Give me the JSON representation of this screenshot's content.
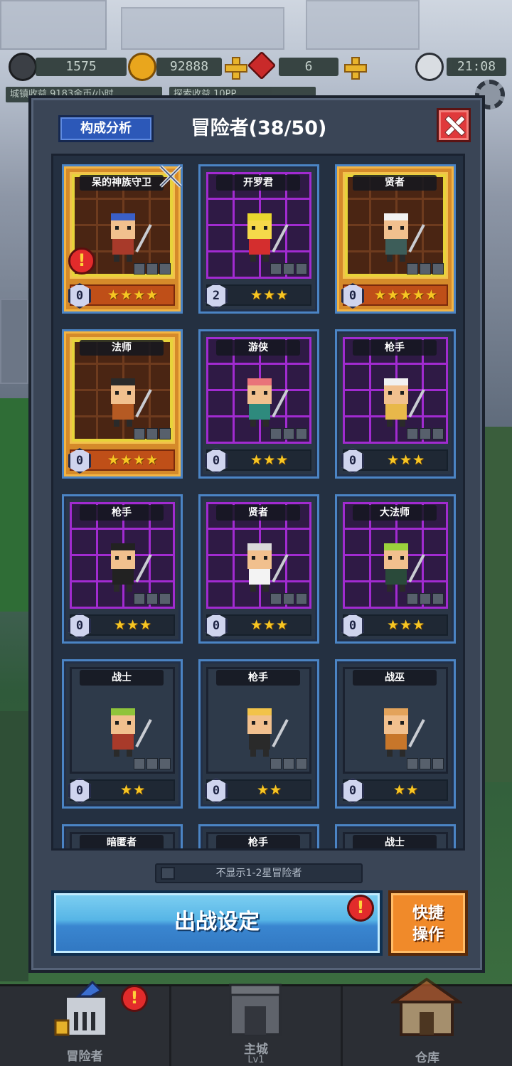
{
  "hud": {
    "power_value": "1575",
    "gold_value": "92888",
    "gem_value": "6",
    "clock": "21:08",
    "sub_left": "城镇收益  9183金币/小时",
    "sub_mid": "探索收益  10PP"
  },
  "modal": {
    "analysis_label": "构成分析",
    "title": "冒险者(38/50)",
    "close_icon": "close-x-icon"
  },
  "cards": [
    {
      "name": "呆的神族守卫",
      "level": "0",
      "stars": "★★★★",
      "frame": "gold",
      "alert": true,
      "swords": true
    },
    {
      "name": "开罗君",
      "level": "2",
      "stars": "★★★",
      "frame": "purple"
    },
    {
      "name": "贤者",
      "level": "0",
      "stars": "★★★★★",
      "frame": "gold"
    },
    {
      "name": "法师",
      "level": "0",
      "stars": "★★★★",
      "frame": "gold"
    },
    {
      "name": "游侠",
      "level": "0",
      "stars": "★★★",
      "frame": "purple"
    },
    {
      "name": "枪手",
      "level": "0",
      "stars": "★★★",
      "frame": "purple"
    },
    {
      "name": "枪手",
      "level": "0",
      "stars": "★★★",
      "frame": "purple"
    },
    {
      "name": "贤者",
      "level": "0",
      "stars": "★★★",
      "frame": "purple"
    },
    {
      "name": "大法师",
      "level": "0",
      "stars": "★★★",
      "frame": "purple"
    },
    {
      "name": "战士",
      "level": "0",
      "stars": "★★",
      "frame": "plain"
    },
    {
      "name": "枪手",
      "level": "0",
      "stars": "★★",
      "frame": "plain"
    },
    {
      "name": "战巫",
      "level": "0",
      "stars": "★★",
      "frame": "plain"
    },
    {
      "name": "暗匿者",
      "level": "",
      "stars": "",
      "frame": "plain"
    },
    {
      "name": "枪手",
      "level": "",
      "stars": "",
      "frame": "plain"
    },
    {
      "name": "战士",
      "level": "",
      "stars": "",
      "frame": "plain"
    }
  ],
  "filter": {
    "label": "不显示1-2星冒险者",
    "checked": false
  },
  "actions": {
    "sortie_label": "出战设定",
    "quick_label_line1": "快捷",
    "quick_label_line2": "操作"
  },
  "nav": {
    "adventurers": "冒险者",
    "castle": "主城",
    "castle_level": "Lv1",
    "warehouse": "仓库"
  },
  "colors": {
    "frame_blue": "#4b84c4",
    "gold_card": "#d58a2a",
    "purple_grid": "#a12bd0",
    "star": "#f7c623",
    "alert": "#e22b2b"
  }
}
